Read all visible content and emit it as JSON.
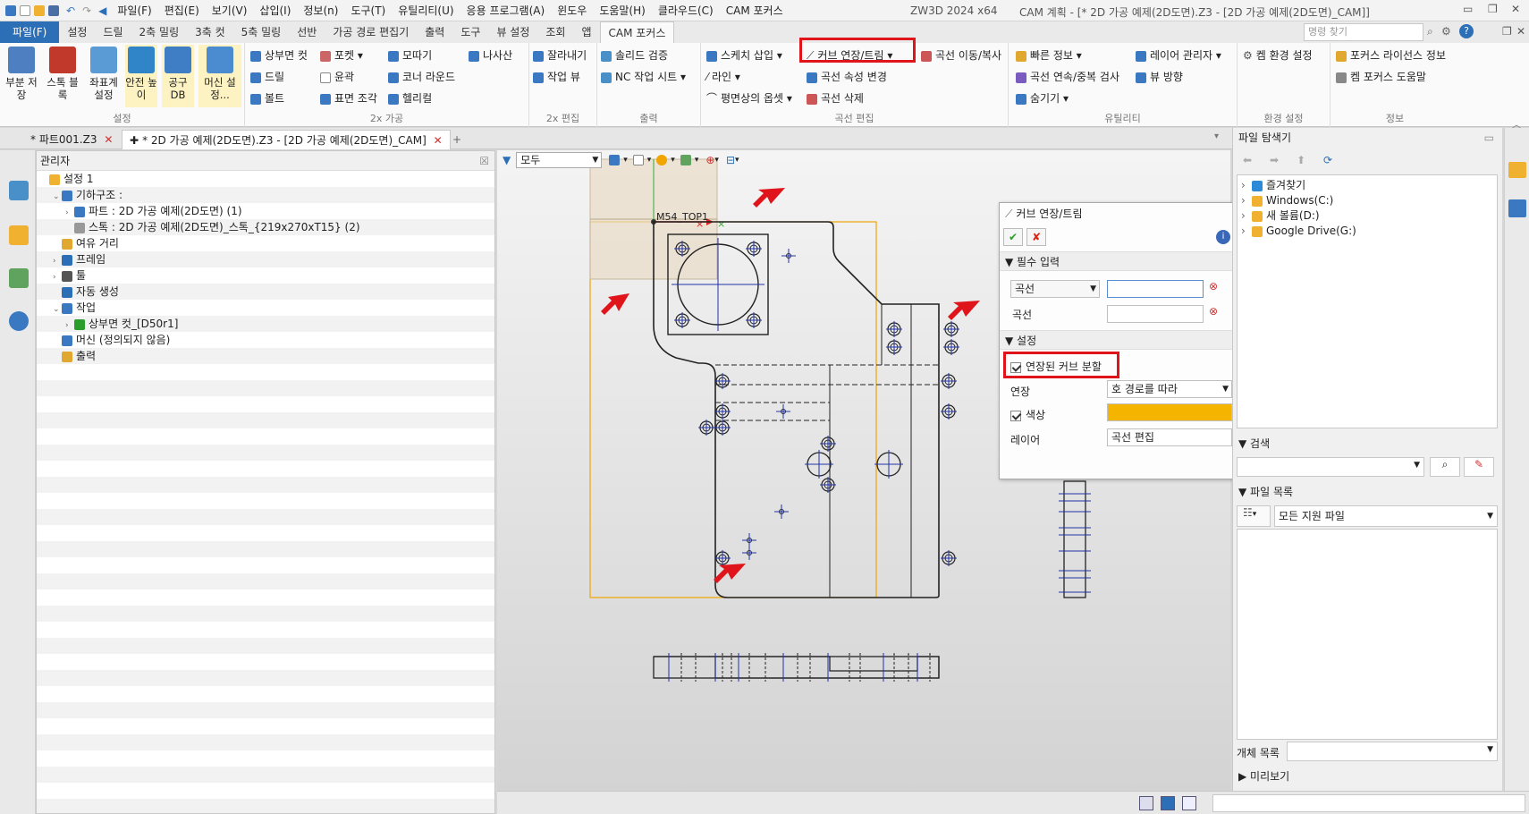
{
  "titlebar": {
    "menu": [
      "파일(F)",
      "편집(E)",
      "보기(V)",
      "삽입(I)",
      "정보(n)",
      "도구(T)",
      "유틸리티(U)",
      "응용 프로그램(A)",
      "윈도우",
      "도움말(H)",
      "클라우드(C)",
      "CAM 포커스"
    ],
    "app_name": "ZW3D 2024 x64",
    "doc_title": "CAM 계획 - [* 2D 가공 예제(2D도면).Z3 - [2D 가공 예제(2D도면)_CAM]]"
  },
  "ribbon_tabs": [
    "파일(F)",
    "설정",
    "드릴",
    "2축 밀링",
    "3축 컷",
    "5축 밀링",
    "선반",
    "가공 경로 편집기",
    "출력",
    "도구",
    "뷰 설정",
    "조회",
    "앱",
    "CAM 포커스"
  ],
  "search": {
    "placeholder": "명령 찾기"
  },
  "ribbon": {
    "setup": {
      "label": "설정",
      "buttons": [
        "부분 저장",
        "스톡 블록",
        "좌표계 설정",
        "안전 높이",
        "공구 DB",
        "머신 설정..."
      ]
    },
    "g2x": {
      "label": "2x 가공",
      "items": [
        "상부면 컷",
        "포켓",
        "모따기",
        "나사산",
        "드릴",
        "윤곽",
        "코너 라운드",
        "볼트",
        "표면 조각",
        "헬리컬"
      ]
    },
    "edit2x": {
      "label": "2x 편집",
      "items": [
        "잘라내기",
        "작업 뷰"
      ]
    },
    "output": {
      "label": "출력",
      "items": [
        "솔리드 검증",
        "NC 작업 시트"
      ]
    },
    "curve": {
      "label": "곡선 편집",
      "items": [
        "스케치 삽입",
        "커브 연장/트림",
        "곡선 이동/복사",
        "라인",
        "곡선 속성 변경",
        "평면상의 옵셋",
        "곡선 삭제"
      ]
    },
    "util": {
      "label": "유틸리티",
      "items": [
        "빠른 정보",
        "레이어 관리자",
        "곡선 연속/중복 검사",
        "숨기기",
        "뷰 방향"
      ]
    },
    "env": {
      "label": "환경 설정",
      "items": [
        "켐 환경 설정"
      ]
    },
    "info": {
      "label": "정보",
      "items": [
        "포커스 라이선스 정보",
        "켐 포커스 도움말"
      ]
    }
  },
  "doc_tabs": [
    "* 파트001.Z3",
    "* 2D 가공 예제(2D도면).Z3 - [2D 가공 예제(2D도면)_CAM]"
  ],
  "manager": {
    "title": "관리자",
    "tree": [
      {
        "label": "설정 1",
        "indent": 0
      },
      {
        "label": "기하구조 :",
        "indent": 1
      },
      {
        "label": "파트 : 2D 가공 예제(2D도면) (1)",
        "indent": 2
      },
      {
        "label": "스톡 : 2D 가공 예제(2D도면)_스톡_{219x270xT15} (2)",
        "indent": 2
      },
      {
        "label": "여유 거리",
        "indent": 1
      },
      {
        "label": "프레임",
        "indent": 1
      },
      {
        "label": "툴",
        "indent": 1
      },
      {
        "label": "자동 생성",
        "indent": 1
      },
      {
        "label": "작업",
        "indent": 1
      },
      {
        "label": "상부면 컷_[D50r1]",
        "indent": 2
      },
      {
        "label": "머신 (정의되지 않음)",
        "indent": 1
      },
      {
        "label": "출력",
        "indent": 1
      }
    ]
  },
  "viewport": {
    "filter": "모두",
    "csys_label": "M54_TOP1"
  },
  "dialog": {
    "title": "커브 연장/트림",
    "required_section": "필수 입력",
    "curve_dropdown": "곡선",
    "curve_label": "곡선",
    "settings_section": "설정",
    "split_checkbox": "연장된 커브 분할",
    "extend_label": "연장",
    "extend_value": "호 경로를 따라",
    "color_label": "색상",
    "color_value": "#f5b400",
    "layer_label": "레이어",
    "layer_value": "곡선 편집"
  },
  "file_explorer": {
    "title": "파일 탐색기",
    "items": [
      "즐겨찾기",
      "Windows(C:)",
      "새 볼륨(D:)",
      "Google Drive(G:)"
    ],
    "search_label": "검색",
    "file_list_label": "파일 목록",
    "filter_value": "모든 지원 파일",
    "object_list_label": "개체 목록",
    "preview_label": "미리보기"
  },
  "colors": {
    "accent": "#2c6fb6",
    "highlight_red": "#e0151b",
    "stock_orange": "#f0a500"
  }
}
